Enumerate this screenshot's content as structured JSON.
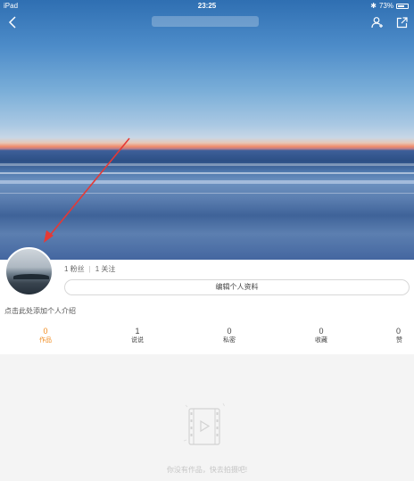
{
  "status_bar": {
    "device": "iPad",
    "time": "23:25",
    "battery_text": "73%",
    "battery_level": 0.73
  },
  "nav": {
    "back_icon": "chevron-left-icon",
    "user_icon": "add-user-icon",
    "share_icon": "share-icon"
  },
  "profile": {
    "fans": "1 粉丝",
    "following": "1 关注",
    "separator": "|",
    "edit_button": "编辑个人资料",
    "intro_placeholder": "点击此处添加个人介绍"
  },
  "tabs": [
    {
      "count": "0",
      "label": "作品",
      "active": true
    },
    {
      "count": "1",
      "label": "说说",
      "active": false
    },
    {
      "count": "0",
      "label": "私密",
      "active": false
    },
    {
      "count": "0",
      "label": "收藏",
      "active": false
    },
    {
      "count": "0",
      "label": "赞",
      "active": false
    }
  ],
  "empty_state": {
    "icon": "film-icon",
    "message": "你没有作品，快去拍摄吧!"
  },
  "colors": {
    "accent": "#f08a1c",
    "annotation_arrow": "#e53935"
  }
}
